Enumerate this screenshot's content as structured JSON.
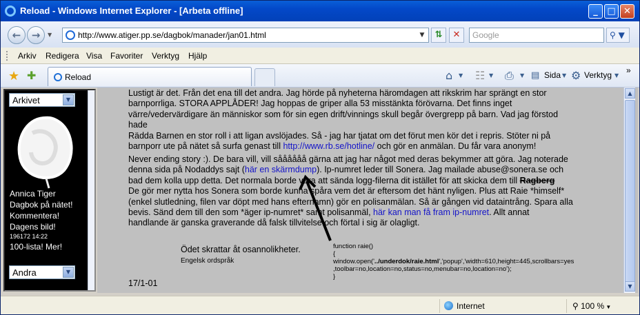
{
  "window": {
    "title": "Reload - Windows Internet Explorer - [Arbeta offline]",
    "minimize": "_",
    "maximize": "□",
    "close": "✕"
  },
  "address_bar": {
    "url": "http://www.atiger.pp.se/dagbok/manader/jan01.html",
    "search_placeholder": "Google",
    "back_icon": "arrow-left-icon",
    "forward_icon": "arrow-right-icon"
  },
  "menu": [
    "Arkiv",
    "Redigera",
    "Visa",
    "Favoriter",
    "Verktyg",
    "Hjälp"
  ],
  "tab": {
    "label": "Reload"
  },
  "toolbar": {
    "page_label": "Sida",
    "tools_label": "Verktyg"
  },
  "sidebar": {
    "archive_select": "Arkivet",
    "author": "Annica Tiger",
    "links": [
      "Dagbok på nätet!",
      "Kommentera!",
      "Dagens bild!"
    ],
    "counter": "196172 14:22",
    "list_link": "100-lista! Mer!",
    "other_select": "Andra"
  },
  "article": {
    "para1": [
      "Lustigt är det. Från det ena till det andra. Jag hörde på nyheterna häromdagen att rikskrim har sprängt en stor",
      "barnporrliga. STORA APPLÅDER! Jag hoppas de griper alla 53 misstänkta förövarna. Det finns inget",
      "värre/vedervärdigare än människor som för sin egen drift/vinnings skull begår övergrepp på barn. Vad jag förstod hade",
      "Rädda Barnen en stor roll i att ligan avslöjades. Så - jag har tjatat om det förut men kör det i repris. Stöter ni på",
      "barnporr ute på nätet så surfa genast till "
    ],
    "para1_link": "http://www.rb.se/hotline/",
    "para1_end": " och gör en anmälan. Du får vara anonym!",
    "para2_l1": "Never ending story :). De bara vill, vill såååååå gärna att jag har något med deras bekymmer att göra. Jag noterade",
    "para2_l2a": "denna sida på Nodaddys sajt (",
    "para2_link1": "här en skärmdump",
    "para2_l2b": "). Ip-numret leder till Sonera. Jag mailade abuse@sonera.se och",
    "para2_l3a": "bad dem kolla upp detta. Det normala borde vara att sända logg-filerna dit istället för att skicka dem till ",
    "para2_strike": "Ragberg",
    "para2_l4": "De gör mer nytta hos Sonera som borde kunna spåra vem det är eftersom det hänt nyligen. Plus att Raie *himself*",
    "para2_l5": "(enkel slutledning, filen var döpt med hans efternamn) gör en polisanmälan. Så är gången vid dataintrång. Spara alla",
    "para2_l6a": "bevis. Sänd dem till den som *äger ip-numret* samt polisanmäl, ",
    "para2_link2": "här kan man få fram ip-numret",
    "para2_l6b": ". Allt annat",
    "para2_l7": "handlande är ganska graverande då falsk tillvitelse och förtal i sig är olagligt."
  },
  "quote": {
    "text": "Ödet skrattar åt osannolikheter.",
    "source": "Engelsk ordspråk"
  },
  "code": {
    "line1": "function raie()",
    "line2": "{",
    "line3a": "window.open('",
    "line3b": "../underdok/raie.html",
    "line3c": "','popup','width=610,height=445,scrollbars=yes",
    "line4": ",toolbar=no,location=no,status=no,menubar=no,location=no');",
    "line5": "}"
  },
  "date": "17/1-01",
  "status": {
    "zone": "Internet",
    "zoom": "100 %"
  },
  "colors": {
    "title_bar": "#0348c8",
    "link": "#1313c8",
    "content_bg": "#c0c0c0"
  }
}
